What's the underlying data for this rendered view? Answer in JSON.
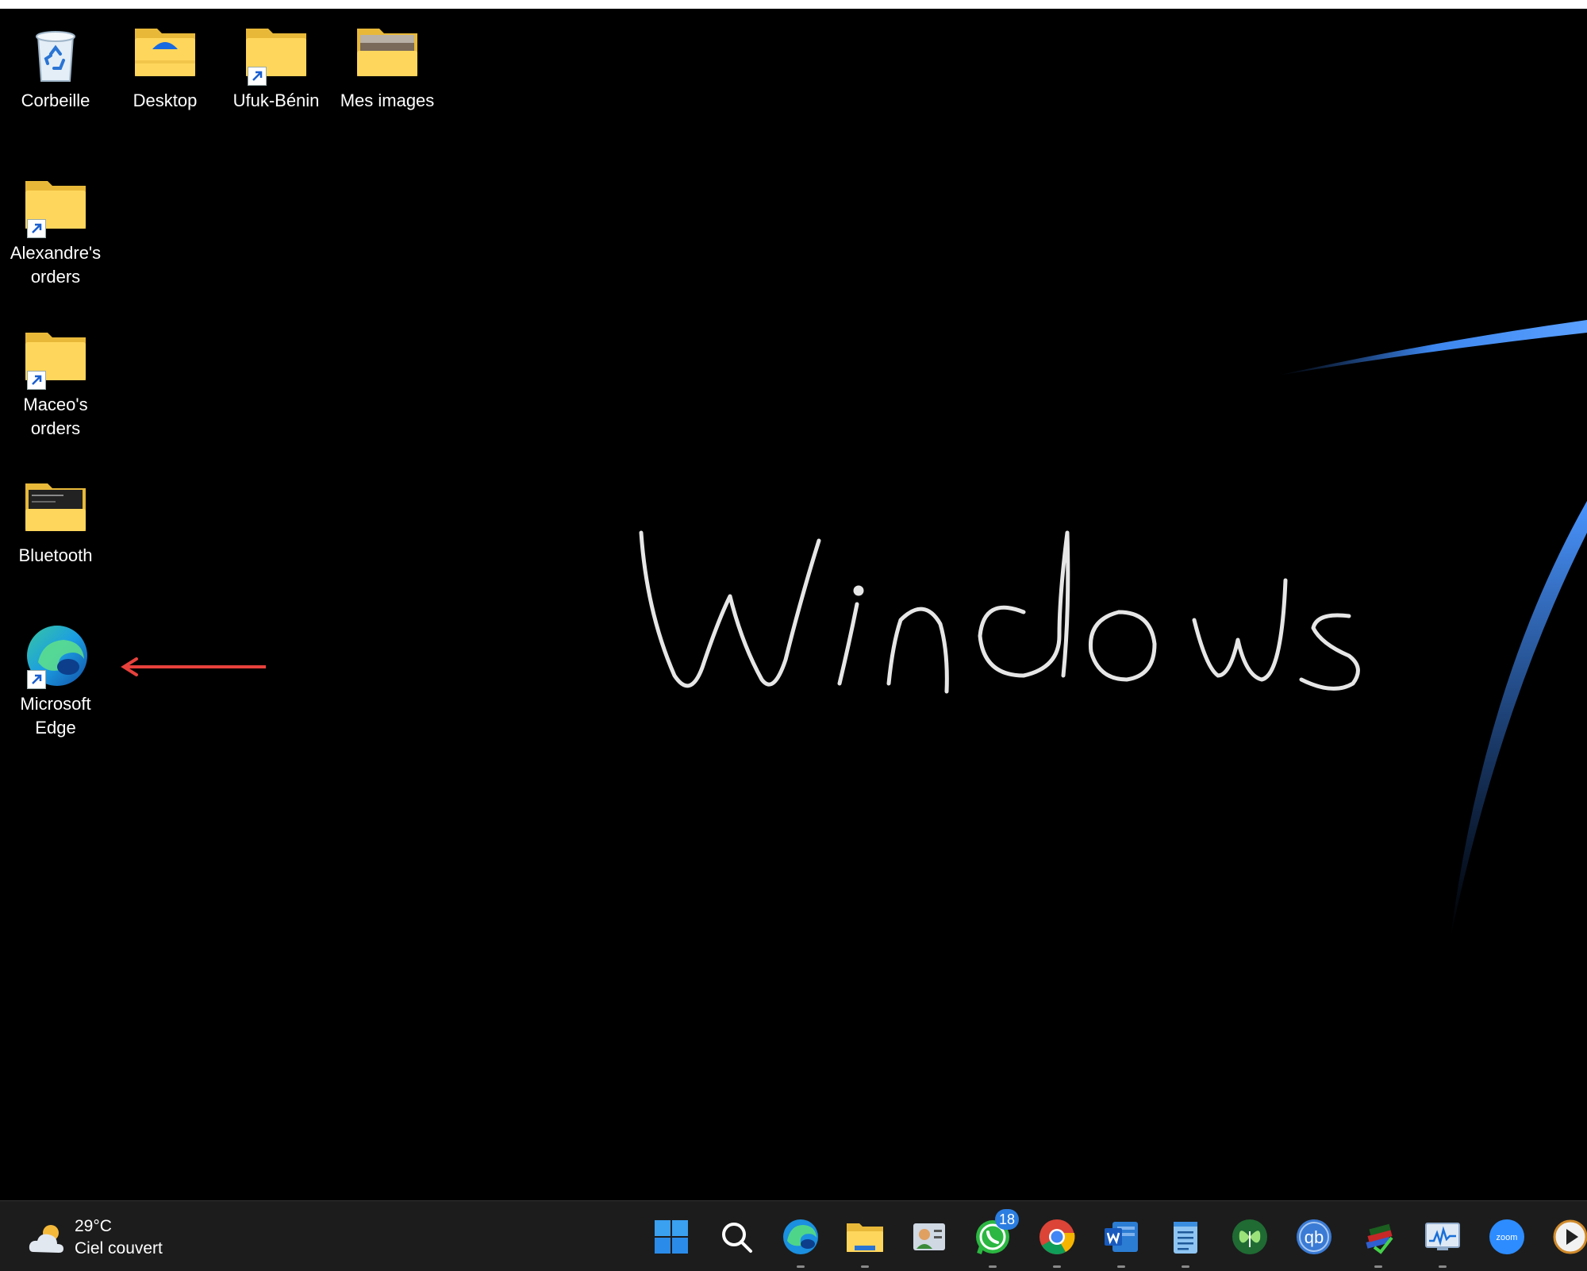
{
  "desktop": {
    "icons": [
      {
        "name": "recycle-bin",
        "label": "Corbeille"
      },
      {
        "name": "desktop-folder",
        "label": "Desktop"
      },
      {
        "name": "ufuk-benin-folder",
        "label": "Ufuk-Bénin"
      },
      {
        "name": "mes-images-folder",
        "label": "Mes images"
      },
      {
        "name": "alexandres-orders-folder",
        "label": "Alexandre's orders"
      },
      {
        "name": "maceos-orders-folder",
        "label": "Maceo's orders"
      },
      {
        "name": "bluetooth-folder",
        "label": "Bluetooth"
      },
      {
        "name": "microsoft-edge-shortcut",
        "label": "Microsoft Edge"
      }
    ],
    "wallpaper_text": "Windows",
    "annotation_color": "#e8413c"
  },
  "taskbar": {
    "weather": {
      "temperature": "29°C",
      "condition": "Ciel couvert",
      "icon": "cloud-sun-icon"
    },
    "apps": [
      {
        "name": "start-button",
        "icon": "windows-logo-icon"
      },
      {
        "name": "search-button",
        "icon": "search-icon"
      },
      {
        "name": "edge-app",
        "icon": "edge-icon"
      },
      {
        "name": "file-explorer-app",
        "icon": "folder-icon"
      },
      {
        "name": "contacts-app",
        "icon": "contacts-icon"
      },
      {
        "name": "whatsapp-app",
        "icon": "whatsapp-icon",
        "badge": "18"
      },
      {
        "name": "chrome-app",
        "icon": "chrome-icon"
      },
      {
        "name": "word-app",
        "icon": "word-icon"
      },
      {
        "name": "notepad-app",
        "icon": "notepad-icon"
      },
      {
        "name": "butterfly-app",
        "icon": "butterfly-icon"
      },
      {
        "name": "qbittorrent-app",
        "icon": "qbittorrent-icon"
      },
      {
        "name": "books-app",
        "icon": "books-icon"
      },
      {
        "name": "resource-monitor-app",
        "icon": "monitor-icon"
      },
      {
        "name": "zoom-app",
        "icon": "zoom-icon",
        "text": "zoom"
      },
      {
        "name": "media-player-app",
        "icon": "play-icon"
      }
    ]
  }
}
